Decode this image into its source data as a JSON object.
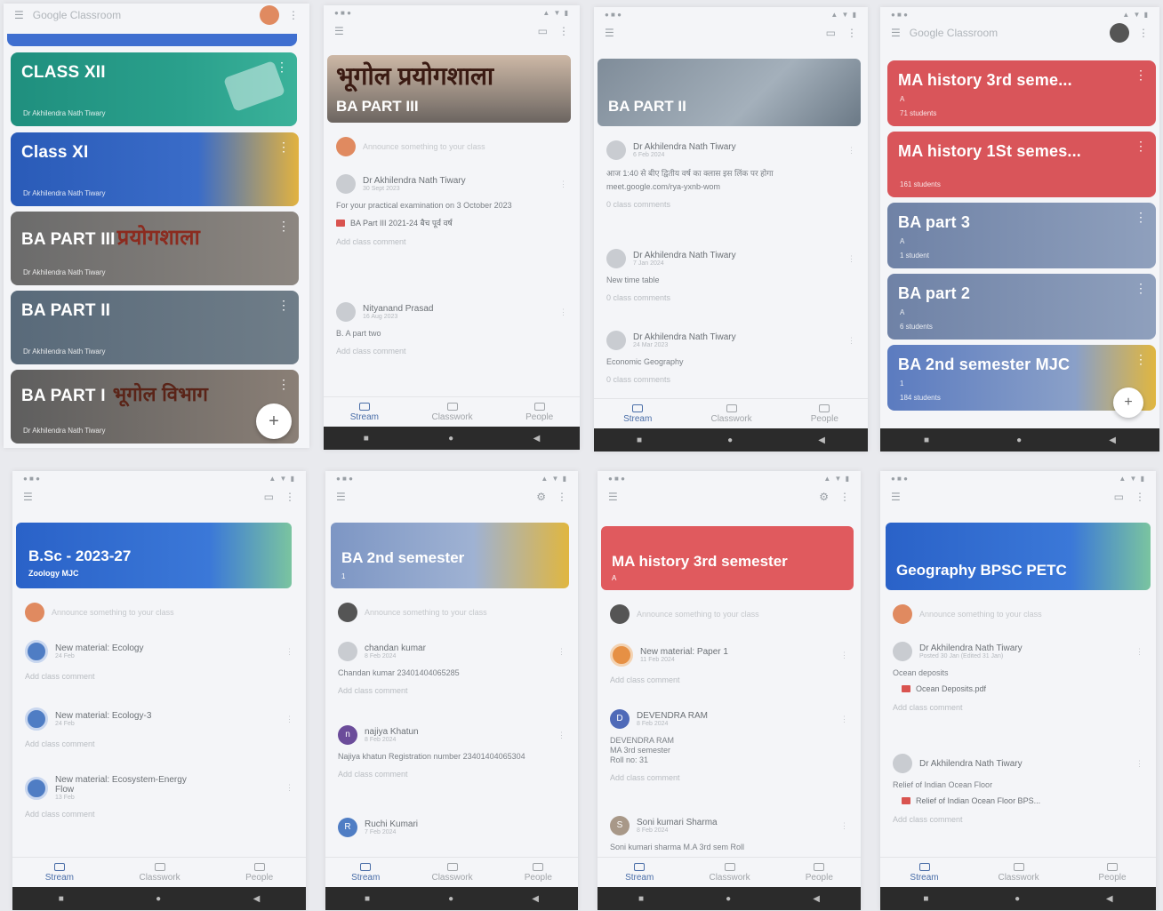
{
  "p1": {
    "app_title": "Google Classroom",
    "cards": [
      {
        "name": "CLASS XII",
        "teacher": "Dr Akhilendra Nath Tiwary"
      },
      {
        "name": "Class XI",
        "teacher": "Dr Akhilendra Nath Tiwary"
      },
      {
        "name": "BA PART III",
        "overlay": "प्रयोगशाला",
        "teacher": "Dr Akhilendra Nath Tiwary"
      },
      {
        "name": "BA PART II",
        "teacher": "Dr Akhilendra Nath Tiwary"
      },
      {
        "name": "BA PART I",
        "overlay": "भूगोल विभाग",
        "teacher": "Dr Akhilendra Nath Tiwary"
      }
    ],
    "fab": "+"
  },
  "p2": {
    "banner_hi": "भूगोल प्रयोगशाला",
    "banner_en": "BA PART III",
    "announce": "Announce something to your class",
    "posts": [
      {
        "author": "Dr Akhilendra Nath Tiwary",
        "date": "30 Sept 2023",
        "body": "For your practical examination on 3 October 2023",
        "chip": "BA Part III 2021-24 बैच पूर्व वर्ष",
        "comment": "Add class comment"
      },
      {
        "author": "Nityanand Prasad",
        "date": "16 Aug 2023",
        "body": "B. A part two",
        "comment": "Add class comment"
      }
    ],
    "tabs": [
      "Stream",
      "Classwork",
      "People"
    ]
  },
  "p3": {
    "banner": "BA PART II",
    "posts": [
      {
        "author": "Dr Akhilendra Nath Tiwary",
        "date": "6 Feb 2024",
        "body": "आज 1:40 से बीए द्वितीय वर्ष का क्लास इस लिंक पर होगा",
        "link": "meet.google.com/rya-yxnb-wom",
        "comment": "0 class comments"
      },
      {
        "author": "Dr Akhilendra Nath Tiwary",
        "date": "7 Jan 2024",
        "body": "New time table",
        "comment": "0 class comments"
      },
      {
        "author": "Dr Akhilendra Nath Tiwary",
        "date": "24 Mar 2023",
        "body": "Economic Geography",
        "comment": "0 class comments"
      }
    ],
    "tabs": [
      "Stream",
      "Classwork",
      "People"
    ]
  },
  "p4": {
    "cards": [
      {
        "name": "MA history 3rd seme...",
        "section": "A",
        "students": "71 students",
        "color": "#d9555a"
      },
      {
        "name": "MA history 1St semes...",
        "section": "",
        "students": "161 students",
        "color": "#d9555a"
      },
      {
        "name": "BA part 3",
        "section": "A",
        "students": "1 student",
        "color": "#6f82a6"
      },
      {
        "name": "BA part 2",
        "section": "A",
        "students": "6 students",
        "color": "#6f82a6"
      },
      {
        "name": "BA 2nd semester MJC",
        "section": "1",
        "students": "184 students",
        "color": "#5b7bc0"
      }
    ],
    "fab": "+"
  },
  "p5": {
    "banner": "B.Sc - 2023-27",
    "banner_sub": "Zoology MJC",
    "announce": "Announce something to your class",
    "posts": [
      {
        "title": "New material: Ecology",
        "date": "24 Feb",
        "comment": "Add class comment"
      },
      {
        "title": "New material: Ecology-3",
        "date": "24 Feb",
        "comment": "Add class comment"
      },
      {
        "title": "New material: Ecosystem-Energy Flow",
        "date": "13 Feb",
        "comment": "Add class comment"
      }
    ],
    "tabs": [
      "Stream",
      "Classwork",
      "People"
    ]
  },
  "p6": {
    "banner": "BA 2nd semester",
    "banner_sub": "1",
    "announce": "Announce something to your class",
    "posts": [
      {
        "author": "chandan kumar",
        "date": "8 Feb 2024",
        "body": "Chandan kumar 23401404065285",
        "comment": "Add class comment"
      },
      {
        "author": "najiya Khatun",
        "date": "8 Feb 2024",
        "body": "Najiya khatun Registration number 23401404065304",
        "comment": "Add class comment",
        "initial": "n"
      },
      {
        "author": "Ruchi Kumari",
        "date": "7 Feb 2024",
        "initial": "R"
      }
    ],
    "tabs": [
      "Stream",
      "Classwork",
      "People"
    ]
  },
  "p7": {
    "banner": "MA history 3rd semester",
    "banner_sub": "A",
    "announce": "Announce something to your class",
    "posts": [
      {
        "title": "New material: Paper 1",
        "date": "11 Feb 2024",
        "comment": "Add class comment"
      },
      {
        "author": "DEVENDRA RAM",
        "date": "8 Feb 2024",
        "body_lines": [
          "DEVENDRA RAM",
          "MA 3rd semester",
          "Roll no: 31"
        ],
        "comment": "Add class comment",
        "initial": "D"
      },
      {
        "author": "Soni kumari Sharma",
        "date": "8 Feb 2024",
        "body": "Soni kumari sharma M.A 3rd sem Roll",
        "initial": "S"
      }
    ],
    "tabs": [
      "Stream",
      "Classwork",
      "People"
    ]
  },
  "p8": {
    "banner": "Geography BPSC PETC",
    "announce": "Announce something to your class",
    "posts": [
      {
        "author": "Dr Akhilendra Nath Tiwary",
        "date": "Posted 30 Jan (Edited 31 Jan)",
        "body": "Ocean deposits",
        "chip": "Ocean Deposits.pdf",
        "comment": "Add class comment"
      },
      {
        "author": "Dr Akhilendra Nath Tiwary",
        "date": "",
        "body": "Relief of Indian Ocean Floor",
        "chip": "Relief of Indian Ocean Floor BPS...",
        "comment": "Add class comment"
      }
    ],
    "tabs": [
      "Stream",
      "Classwork",
      "People"
    ]
  }
}
